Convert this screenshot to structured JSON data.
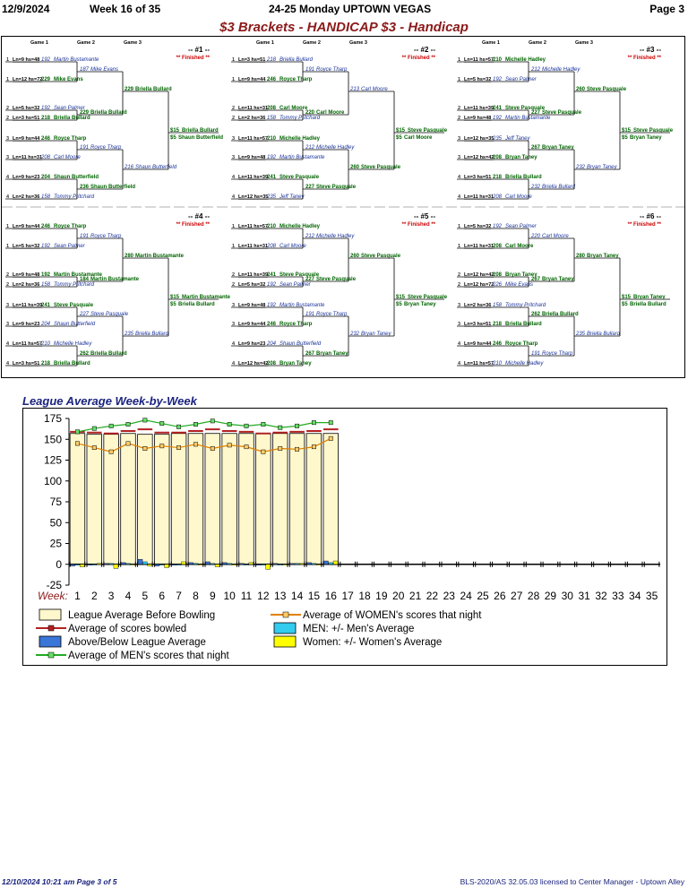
{
  "header": {
    "date": "12/9/2024",
    "week": "Week 16 of 35",
    "league": "24-25 Monday UPTOWN VEGAS",
    "page": "Page 3"
  },
  "title": "$3 Brackets - HANDICAP $3 - Handicap",
  "game_labels": [
    "Game 1",
    "Game 2",
    "Game 3"
  ],
  "brackets": [
    {
      "id": "-- #1 --",
      "status": "** Finished **",
      "r1": [
        [
          "1",
          "Ln=9 hs=48",
          "192",
          "Martin Bustamante"
        ],
        [
          "1",
          "Ln=12 hs=72",
          "229",
          "Mike Evans"
        ],
        [
          "2",
          "Ln=5 hs=32",
          "192",
          "Sean Palmer"
        ],
        [
          "2",
          "Ln=3 hs=51",
          "218",
          "Briella Bullard"
        ],
        [
          "3",
          "Ln=9 hs=44",
          "246",
          "Royce Tharp"
        ],
        [
          "3",
          "Ln=11 hs=31",
          "208",
          "Carl Moore"
        ],
        [
          "4",
          "Ln=9 hs=23",
          "204",
          "Shaun Butterfield"
        ],
        [
          "4",
          "Ln=2 hs=36",
          "158",
          "Tommy Pritchard"
        ]
      ],
      "r2": [
        [
          "187",
          "Mike Evans"
        ],
        [
          "229",
          "Briella Bullard"
        ],
        [
          "191",
          "Royce Tharp"
        ],
        [
          "236",
          "Shaun Butterfield"
        ]
      ],
      "r3": [
        [
          "229",
          "Briella Bullard"
        ],
        [
          "216",
          "Shaun Butterfield"
        ]
      ],
      "win": [
        "$15",
        "Briella Bullard",
        "$5",
        "Shaun Butterfield"
      ]
    },
    {
      "id": "-- #2 --",
      "status": "** Finished **",
      "r1": [
        [
          "1",
          "Ln=3 hs=51",
          "218",
          "Briella Bullard"
        ],
        [
          "1",
          "Ln=9 hs=44",
          "246",
          "Royce Tharp"
        ],
        [
          "2",
          "Ln=11 hs=31",
          "208",
          "Carl Moore"
        ],
        [
          "2",
          "Ln=2 hs=36",
          "158",
          "Tommy Pritchard"
        ],
        [
          "3",
          "Ln=11 hs=57",
          "210",
          "Michelle Hadley"
        ],
        [
          "3",
          "Ln=9 hs=48",
          "192",
          "Martin Bustamante"
        ],
        [
          "4",
          "Ln=11 hs=39",
          "241",
          "Steve Pasquale"
        ],
        [
          "4",
          "Ln=12 hs=35",
          "235",
          "Jeff Taney"
        ]
      ],
      "r2": [
        [
          "191",
          "Royce Tharp"
        ],
        [
          "220",
          "Carl Moore"
        ],
        [
          "212",
          "Michelle Hadley"
        ],
        [
          "227",
          "Steve Pasquale"
        ]
      ],
      "r3": [
        [
          "213",
          "Carl Moore"
        ],
        [
          "260",
          "Steve Pasquale"
        ]
      ],
      "win": [
        "$15",
        "Steve Pasquale",
        "$5",
        "Carl Moore"
      ]
    },
    {
      "id": "-- #3 --",
      "status": "** Finished **",
      "r1": [
        [
          "1",
          "Ln=11 hs=57",
          "210",
          "Michelle Hadley"
        ],
        [
          "1",
          "Ln=5 hs=32",
          "192",
          "Sean Palmer"
        ],
        [
          "2",
          "Ln=11 hs=39",
          "241",
          "Steve Pasquale"
        ],
        [
          "2",
          "Ln=9 hs=48",
          "192",
          "Martin Bustamante"
        ],
        [
          "3",
          "Ln=12 hs=35",
          "235",
          "Jeff Taney"
        ],
        [
          "3",
          "Ln=12 hs=42",
          "208",
          "Bryan Taney"
        ],
        [
          "4",
          "Ln=3 hs=51",
          "218",
          "Briella Bullard"
        ],
        [
          "4",
          "Ln=11 hs=31",
          "208",
          "Carl Moore"
        ]
      ],
      "r2": [
        [
          "212",
          "Michelle Hadley"
        ],
        [
          "227",
          "Steve Pasquale"
        ],
        [
          "267",
          "Bryan Taney"
        ],
        [
          "232",
          "Briella Bullard"
        ]
      ],
      "r3": [
        [
          "260",
          "Steve Pasquale"
        ],
        [
          "232",
          "Bryan Taney"
        ]
      ],
      "win": [
        "$15",
        "Steve Pasquale",
        "$5",
        "Bryan Taney"
      ]
    },
    {
      "id": "-- #4 --",
      "status": "** Finished **",
      "r1": [
        [
          "1",
          "Ln=9 hs=44",
          "246",
          "Royce Tharp"
        ],
        [
          "1",
          "Ln=5 hs=32",
          "192",
          "Sean Palmer"
        ],
        [
          "2",
          "Ln=9 hs=48",
          "192",
          "Martin Bustamante"
        ],
        [
          "2",
          "Ln=2 hs=36",
          "158",
          "Tommy Pritchard"
        ],
        [
          "3",
          "Ln=11 hs=39",
          "241",
          "Steve Pasquale"
        ],
        [
          "3",
          "Ln=9 hs=23",
          "204",
          "Shaun Butterfield"
        ],
        [
          "4",
          "Ln=11 hs=57",
          "210",
          "Michelle Hadley"
        ],
        [
          "4",
          "Ln=3 hs=51",
          "218",
          "Briella Bullard"
        ]
      ],
      "r2": [
        [
          "191",
          "Royce Tharp"
        ],
        [
          "184",
          "Martin Bustamante"
        ],
        [
          "227",
          "Steve Pasquale"
        ],
        [
          "262",
          "Briella Bullard"
        ]
      ],
      "r3": [
        [
          "280",
          "Martin Bustamante"
        ],
        [
          "235",
          "Briella Bullard"
        ]
      ],
      "win": [
        "$15",
        "Martin Bustamante",
        "$5",
        "Briella Bullard"
      ]
    },
    {
      "id": "-- #5 --",
      "status": "** Finished **",
      "r1": [
        [
          "1",
          "Ln=11 hs=57",
          "210",
          "Michelle Hadley"
        ],
        [
          "1",
          "Ln=11 hs=31",
          "208",
          "Carl Moore"
        ],
        [
          "2",
          "Ln=11 hs=39",
          "241",
          "Steve Pasquale"
        ],
        [
          "2",
          "Ln=5 hs=32",
          "192",
          "Sean Palmer"
        ],
        [
          "3",
          "Ln=9 hs=48",
          "192",
          "Martin Bustamante"
        ],
        [
          "3",
          "Ln=9 hs=44",
          "246",
          "Royce Tharp"
        ],
        [
          "4",
          "Ln=9 hs=23",
          "204",
          "Shaun Butterfield"
        ],
        [
          "4",
          "Ln=12 hs=42",
          "208",
          "Bryan Taney"
        ]
      ],
      "r2": [
        [
          "212",
          "Michelle Hadley"
        ],
        [
          "227",
          "Steve Pasquale"
        ],
        [
          "191",
          "Royce Tharp"
        ],
        [
          "267",
          "Bryan Taney"
        ]
      ],
      "r3": [
        [
          "260",
          "Steve Pasquale"
        ],
        [
          "232",
          "Bryan Taney"
        ]
      ],
      "win": [
        "$15",
        "Steve Pasquale",
        "$5",
        "Bryan Taney"
      ]
    },
    {
      "id": "-- #6 --",
      "status": "** Finished **",
      "r1": [
        [
          "1",
          "Ln=5 hs=32",
          "192",
          "Sean Palmer"
        ],
        [
          "1",
          "Ln=11 hs=31",
          "208",
          "Carl Moore"
        ],
        [
          "2",
          "Ln=12 hs=42",
          "208",
          "Bryan Taney"
        ],
        [
          "2",
          "Ln=12 hs=72",
          "226",
          "Mike Evans"
        ],
        [
          "3",
          "Ln=2 hs=36",
          "158",
          "Tommy Pritchard"
        ],
        [
          "3",
          "Ln=3 hs=51",
          "218",
          "Briella Bullard"
        ],
        [
          "4",
          "Ln=9 hs=44",
          "246",
          "Royce Tharp"
        ],
        [
          "4",
          "Ln=11 hs=57",
          "210",
          "Michelle Hadley"
        ]
      ],
      "r2": [
        [
          "220",
          "Carl Moore"
        ],
        [
          "267",
          "Bryan Taney"
        ],
        [
          "262",
          "Briella Bullard"
        ],
        [
          "191",
          "Royce Tharp"
        ]
      ],
      "r3": [
        [
          "280",
          "Bryan Taney"
        ],
        [
          "235",
          "Briella Bullard"
        ]
      ],
      "win": [
        "$15",
        "Bryan Taney",
        "$5",
        "Briella Bullard"
      ]
    }
  ],
  "chart_title": "League Average Week-by-Week",
  "chart_data": {
    "type": "bar",
    "xlabel": "Week:",
    "x": [
      1,
      2,
      3,
      4,
      5,
      6,
      7,
      8,
      9,
      10,
      11,
      12,
      13,
      14,
      15,
      16,
      17,
      18,
      19,
      20,
      21,
      22,
      23,
      24,
      25,
      26,
      27,
      28,
      29,
      30,
      31,
      32,
      33,
      34,
      35
    ],
    "ylim": [
      -25,
      175
    ],
    "yticks": [
      -25,
      0,
      25,
      50,
      75,
      100,
      125,
      150,
      175
    ],
    "grid": false,
    "legend_placement": "bottom",
    "series": [
      {
        "name": "League Average Before Bowling",
        "type": "bar",
        "color": "#fff8cc",
        "values": [
          157,
          156,
          156,
          157,
          156,
          156,
          157,
          157,
          157,
          157,
          157,
          157,
          157,
          157,
          157,
          157
        ]
      },
      {
        "name": "Average of scores bowled",
        "type": "line",
        "color": "#b22222",
        "values": [
          159,
          158,
          157,
          160,
          162,
          158,
          158,
          160,
          162,
          160,
          159,
          157,
          158,
          159,
          160,
          162
        ]
      },
      {
        "name": "Above/Below League Average",
        "type": "bar",
        "color": "#3a75d8",
        "values": [
          -2,
          -1,
          1,
          2,
          6,
          -2,
          -1,
          2,
          3,
          2,
          1,
          -1,
          1,
          1,
          2,
          4
        ]
      },
      {
        "name": "Average of MEN's scores that night",
        "type": "line",
        "color": "#22aa22",
        "values": [
          159,
          163,
          166,
          168,
          173,
          169,
          165,
          168,
          172,
          168,
          166,
          168,
          164,
          166,
          170,
          170
        ]
      },
      {
        "name": "Average of WOMEN's scores that night",
        "type": "line",
        "color": "#e08000",
        "values": [
          145,
          140,
          135,
          145,
          139,
          142,
          140,
          144,
          139,
          143,
          141,
          135,
          139,
          138,
          141,
          151
        ]
      },
      {
        "name": "MEN: +/- Men's Average",
        "type": "bar",
        "color": "#33ccee",
        "values": [
          -1,
          -1,
          1,
          1,
          3,
          -1,
          -1,
          1,
          1,
          1,
          0,
          0,
          -1,
          1,
          1,
          2
        ]
      },
      {
        "name": "Women: +/- Women's Average",
        "type": "bar",
        "color": "#ffff00",
        "values": [
          -3,
          1,
          -5,
          0,
          -2,
          -4,
          3,
          -1,
          -3,
          -1,
          2,
          -6,
          -1,
          1,
          0,
          4
        ]
      }
    ]
  },
  "footer": {
    "left": "12/10/2024  10:21 am  Page 3 of 5",
    "right": "BLS-2020/AS 32.05.03 licensed to Center Manager - Uptown Alley"
  }
}
